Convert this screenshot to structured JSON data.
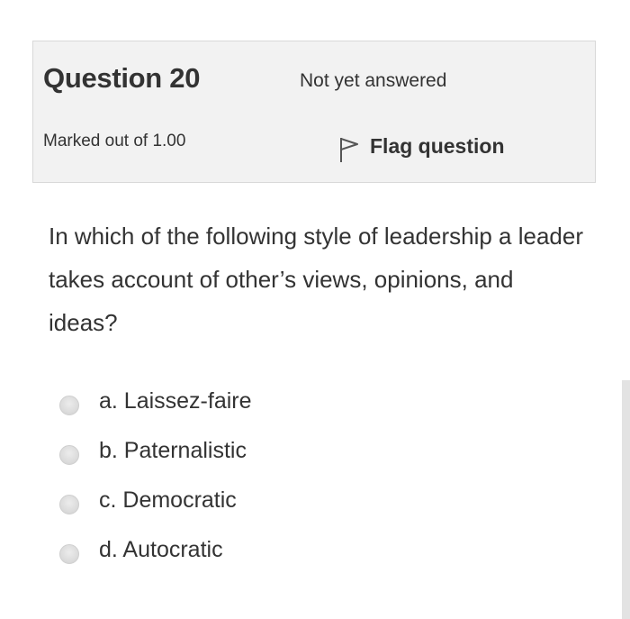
{
  "question_info": {
    "title_prefix": "Question",
    "number": "20",
    "state": "Not yet answered",
    "grade": "Marked out of 1.00",
    "flag_label": "Flag question"
  },
  "question": {
    "text": "In which of the following style of leadership a leader takes account of other’s views, opinions, and ideas?"
  },
  "answers": [
    {
      "label": "a. Laissez-faire",
      "selected": false
    },
    {
      "label": "b. Paternalistic",
      "selected": false
    },
    {
      "label": "c. Democratic",
      "selected": false
    },
    {
      "label": "d. Autocratic",
      "selected": false
    }
  ],
  "colors": {
    "info_background": "#f2f2f2",
    "info_border": "#d8d8d8",
    "text": "#333333",
    "radio": "#dcdcdc",
    "scrollbar": "#e3e3e3"
  },
  "icons": {
    "flag": "flag-icon",
    "radio": "radio-unchecked-icon"
  }
}
